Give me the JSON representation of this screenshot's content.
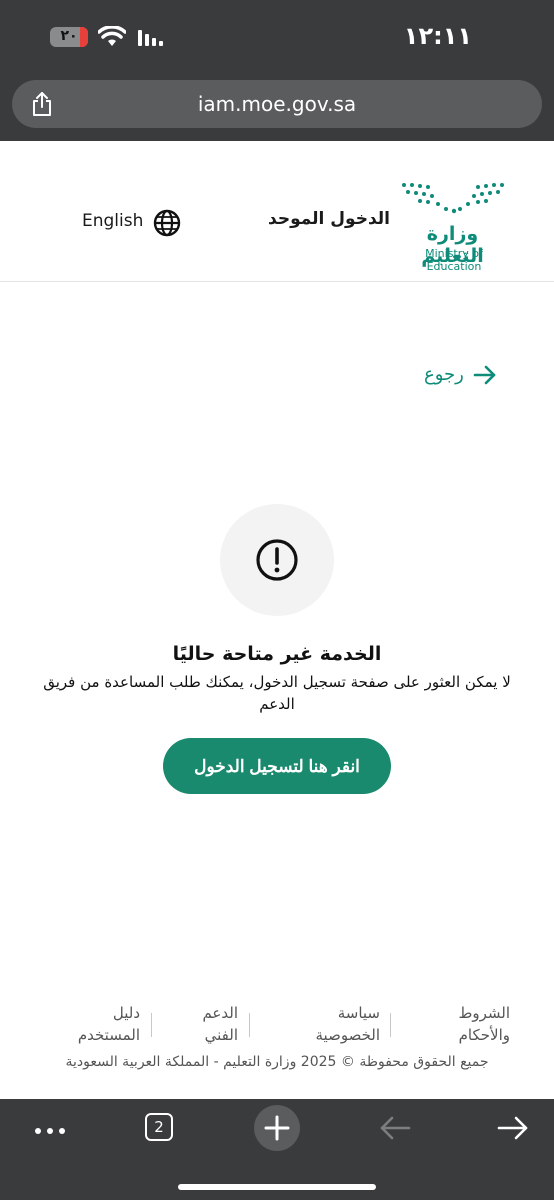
{
  "status": {
    "time": "١٢:١١",
    "battery": "٢٠"
  },
  "browser": {
    "url": "iam.moe.gov.sa",
    "tab_count": "2"
  },
  "header": {
    "logo_ar": "وزارة التعليم",
    "logo_en": "Ministry of Education",
    "sso_title": "الدخول الموحد",
    "language": "English"
  },
  "nav": {
    "back_label": "رجوع"
  },
  "error": {
    "title": "الخدمة غير متاحة حاليًا",
    "description": "لا يمكن العثور على صفحة تسجيل الدخول، يمكنك طلب المساعدة من فريق الدعم",
    "button": "انقر هنا لتسجيل الدخول"
  },
  "footer": {
    "terms": "الشروط والأحكام",
    "privacy": "سياسة الخصوصية",
    "support": "الدعم الفني",
    "guide": "دليل المستخدم",
    "copyright": "جميع الحقوق محفوظة © 2025 وزارة التعليم - المملكة العربية السعودية"
  },
  "colors": {
    "brand": "#1a8a6e",
    "logo": "#0f8b7a",
    "chrome": "#3a3b3d"
  }
}
